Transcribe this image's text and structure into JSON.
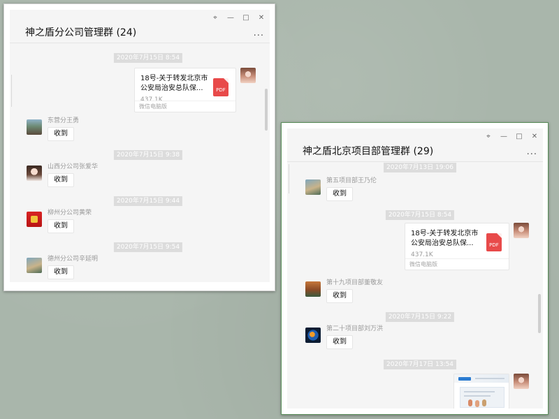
{
  "windows": {
    "left": {
      "title": "神之盾分公司管理群 (24)",
      "controls": {
        "pin_icon": "pin-icon",
        "minimize_icon": "minimize-icon",
        "maximize_icon": "maximize-icon",
        "close_icon": "close-icon"
      },
      "more": "...",
      "messages": [
        {
          "kind": "timestamp",
          "text": "2020年7月15日 8:54"
        },
        {
          "kind": "file",
          "title": "18号-关于转发北京市公安局治安总队保...",
          "size": "437.1K",
          "source": "微信电脑版",
          "badge": "PDF"
        },
        {
          "kind": "text",
          "sender": "东营分王勇",
          "content": "收到"
        },
        {
          "kind": "timestamp",
          "text": "2020年7月15日 9:38"
        },
        {
          "kind": "text",
          "sender": "山西分公司张爱华",
          "content": "收到"
        },
        {
          "kind": "timestamp",
          "text": "2020年7月15日 9:44"
        },
        {
          "kind": "text",
          "sender": "柳州分公司黄荣",
          "content": "收到"
        },
        {
          "kind": "timestamp",
          "text": "2020年7月15日 9:54"
        },
        {
          "kind": "text",
          "sender": "德州分公司辛延明",
          "content": "收到"
        }
      ]
    },
    "right": {
      "title": "神之盾北京项目部管理群 (29)",
      "controls": {
        "pin_icon": "pin-icon",
        "minimize_icon": "minimize-icon",
        "maximize_icon": "maximize-icon",
        "close_icon": "close-icon"
      },
      "more": "...",
      "messages": [
        {
          "kind": "timestamp",
          "text": "2020年7月13日 19:06"
        },
        {
          "kind": "text",
          "sender": "第五项目部王乃伦",
          "content": "收到"
        },
        {
          "kind": "timestamp",
          "text": "2020年7月15日 8:54"
        },
        {
          "kind": "file",
          "title": "18号-关于转发北京市公安局治安总队保...",
          "size": "437.1K",
          "source": "微信电脑版",
          "badge": "PDF"
        },
        {
          "kind": "text",
          "sender": "第十九项目部董敬友",
          "content": "收到"
        },
        {
          "kind": "timestamp",
          "text": "2020年7月15日 9:22"
        },
        {
          "kind": "text",
          "sender": "第二十项目部刘万洪",
          "content": "收到"
        },
        {
          "kind": "timestamp",
          "text": "2020年7月17日 13:54"
        },
        {
          "kind": "image",
          "alt": "image-preview"
        }
      ]
    }
  },
  "colors": {
    "desktop_bg": "#a9b6ab",
    "chat_bg": "#f5f5f5",
    "timestamp_bg": "#dcdcdc",
    "pdf_red": "#e84a4a"
  }
}
